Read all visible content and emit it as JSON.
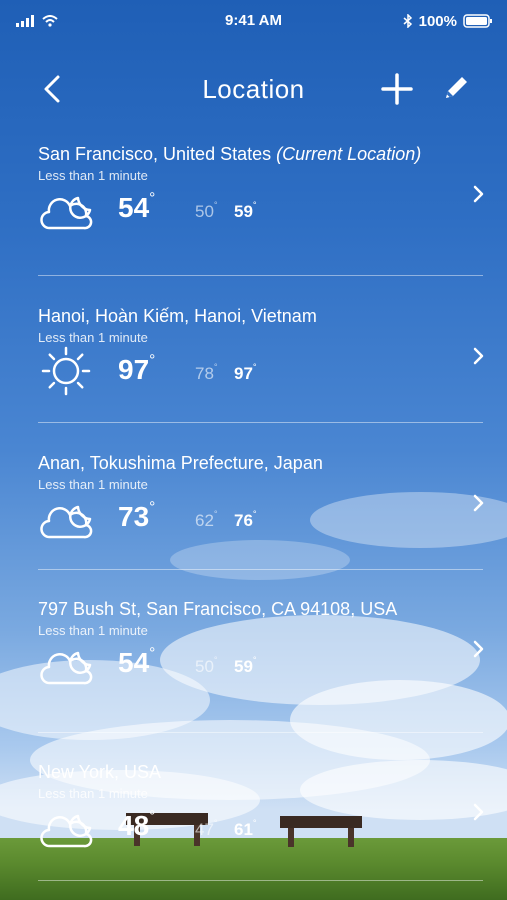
{
  "status_bar": {
    "time": "9:41 AM",
    "battery": "100%",
    "icons": [
      "signal-icon",
      "wifi-icon",
      "bluetooth-icon",
      "battery-icon"
    ]
  },
  "nav": {
    "title": "Location",
    "icons": [
      "back-icon",
      "add-icon",
      "edit-icon"
    ]
  },
  "locations": [
    {
      "name": "San Francisco, United States",
      "current_label": "(Current Location)",
      "updated": "Less than 1 minute",
      "icon": "partly-cloudy-night-icon",
      "temp": "54",
      "low": "50",
      "high": "59"
    },
    {
      "name": "Hanoi, Hoàn Kiếm, Hanoi, Vietnam",
      "current_label": "",
      "updated": "Less than 1 minute",
      "icon": "sunny-icon",
      "temp": "97",
      "low": "78",
      "high": "97"
    },
    {
      "name": "Anan, Tokushima Prefecture, Japan",
      "current_label": "",
      "updated": "Less than 1 minute",
      "icon": "partly-cloudy-night-icon",
      "temp": "73",
      "low": "62",
      "high": "76"
    },
    {
      "name": "797 Bush St, San Francisco, CA 94108, USA",
      "current_label": "",
      "updated": "Less than 1 minute",
      "icon": "partly-cloudy-night-icon",
      "temp": "54",
      "low": "50",
      "high": "59"
    },
    {
      "name": "New York, USA",
      "current_label": "",
      "updated": "Less than 1 minute",
      "icon": "partly-cloudy-night-icon",
      "temp": "48",
      "low": "47",
      "high": "61"
    }
  ],
  "degree": "°"
}
